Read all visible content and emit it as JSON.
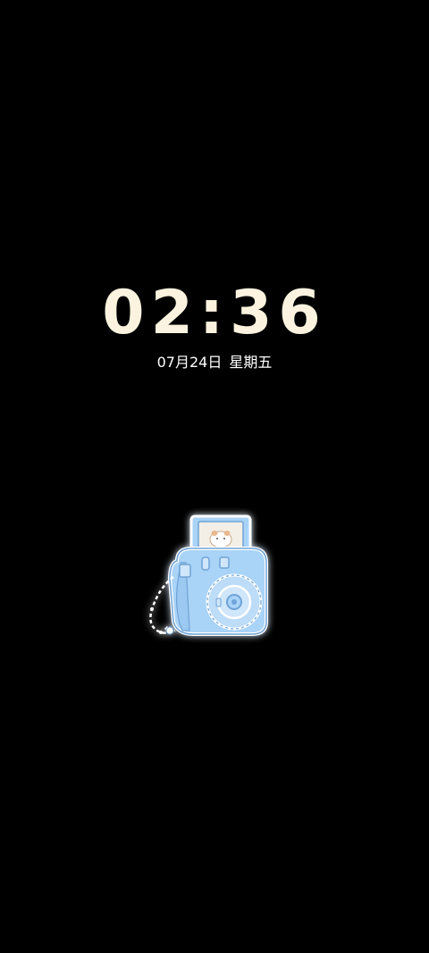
{
  "lockscreen": {
    "time": "02:36",
    "date": "07月24日",
    "weekday": "星期五",
    "sticker_icon": "instant-camera-sticker"
  },
  "colors": {
    "background": "#000000",
    "clock": "#fbf3df",
    "date": "#ffffff",
    "sticker_body": "#a9d3f7",
    "sticker_outline": "#6fa3d6"
  }
}
